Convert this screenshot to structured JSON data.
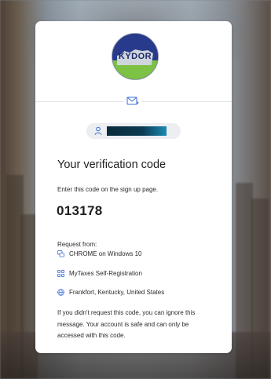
{
  "logo": {
    "text": "KYDOR"
  },
  "user": {
    "name_redacted": true
  },
  "heading": "Your verification code",
  "instruction": "Enter this code on the sign up page.",
  "code": "013178",
  "request": {
    "label": "Request from:",
    "browser": "CHROME on Windows 10",
    "app": "MyTaxes Self-Registration",
    "location": "Frankfort, Kentucky, United States"
  },
  "footnote": "If you didn't request this code, you can ignore this message. Your account is safe and can only be accessed with this code.",
  "icons": {
    "mail": "mail-icon",
    "user": "user-icon",
    "browser": "browser-windows-icon",
    "app": "apps-grid-icon",
    "location": "globe-icon"
  },
  "colors": {
    "accent": "#3a6fd8",
    "card": "#ffffff",
    "text": "#1f1f1f"
  }
}
